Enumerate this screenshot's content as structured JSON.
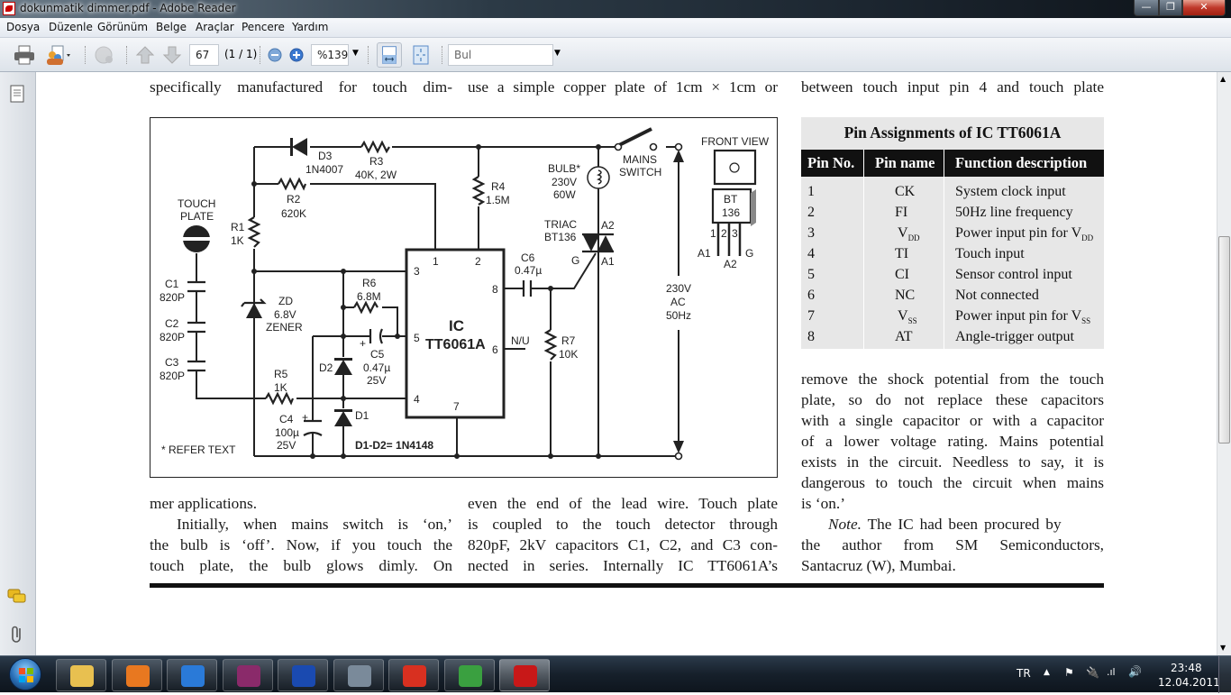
{
  "window": {
    "title": "dokunmatik dimmer.pdf - Adobe Reader",
    "controls": {
      "minimize": "—",
      "maximize": "❐",
      "close": "✕"
    }
  },
  "menu": [
    "Dosya",
    "Düzenle",
    "Görünüm",
    "Belge",
    "Araçlar",
    "Pencere",
    "Yardım"
  ],
  "toolbar": {
    "page_number": "67",
    "page_count": "(1 / 1)",
    "zoom": "%139",
    "find_placeholder": "Bul",
    "icons": [
      "print-icon",
      "collaborate-icon",
      "share-icon",
      "previous-page-icon",
      "next-page-icon",
      "zoom-out-icon",
      "zoom-in-icon",
      "fit-width-icon",
      "fit-page-icon"
    ]
  },
  "left_panel": {
    "icons": [
      "pages-icon",
      "comments-icon",
      "attachments-icon"
    ]
  },
  "document": {
    "col1_top": "specifically manufactured for touch dim-",
    "col2_top": "use a simple copper plate of 1cm × 1cm or",
    "col3_top": "between touch input pin 4 and touch plate",
    "col1_bottom": [
      "mer applications.",
      "Initially, when mains switch is ‘on,’",
      "the bulb is ‘off’. Now, if you touch the",
      "touch plate, the bulb glows dimly. On"
    ],
    "col2_bottom": [
      "even the end of the lead wire. Touch plate",
      "is coupled to the touch detector through",
      "820pF, 2kV capacitors C1, C2, and C3 con-",
      "nected in series. Internally IC TT6061A’s"
    ],
    "col3_bottom": [
      "remove the shock potential from the touch",
      "plate, so do not replace these capacitors",
      "with a single capacitor or with a capacitor",
      "of a lower voltage rating. Mains potential",
      "exists in the circuit. Needless to say, it is",
      "dangerous to touch the circuit when mains",
      "is ‘on.’"
    ],
    "note_label": "Note.",
    "note_rest": " The IC had been procured by",
    "note_lines": [
      "the author from SM Semiconductors,",
      "Santacruz (W), Mumbai."
    ]
  },
  "circuit": {
    "d3": "D3",
    "d3v": "1N4007",
    "r3": "R3",
    "r3v": "40K, 2W",
    "r2": "R2",
    "r2v": "620K",
    "r4": "R4",
    "r4v": "1.5M",
    "touch1": "TOUCH",
    "touch2": "PLATE",
    "r1": "R1",
    "r1v": "1K",
    "c1": "C1",
    "c1v": "820P",
    "c2": "C2",
    "c2v": "820P",
    "c3": "C3",
    "c3v": "820P",
    "zd": "ZD",
    "zdv": "6.8V",
    "zdt": "ZENER",
    "r6": "R6",
    "r6v": "6.8M",
    "c5": "C5",
    "c5v": "0.47µ",
    "c5w": "25V",
    "d2": "D2",
    "d1": "D1",
    "r5": "R5",
    "r5v": "1K",
    "c4": "C4",
    "c4v": "100µ",
    "c4w": "25V",
    "note": "* REFER TEXT",
    "dnote": "D1-D2= 1N4148",
    "ic1": "IC",
    "ic2": "TT6061A",
    "p1": "1",
    "p2": "2",
    "p3": "3",
    "p4": "4",
    "p5": "5",
    "p6": "6",
    "p7": "7",
    "p8": "8",
    "nu": "N/U",
    "c6": "C6",
    "c6v": "0.47µ",
    "r7": "R7",
    "r7v": "10K",
    "bulb": "BULB*",
    "bulbv": "230V",
    "bulbw": "60W",
    "sw1": "MAINS",
    "sw2": "SWITCH",
    "triac": "TRIAC",
    "triacv": "BT136",
    "a2": "A2",
    "a1": "A1",
    "g": "G",
    "ac1": "230V",
    "ac2": "AC",
    "ac3": "50Hz",
    "fv": "FRONT VIEW",
    "bt1": "BT",
    "bt2": "136",
    "l1": "1",
    "l2": "2",
    "l3": "3",
    "la1": "A1",
    "la2": "A2",
    "lg": "G"
  },
  "pin_table": {
    "title": "Pin Assignments of IC TT6061A",
    "headers": [
      "Pin No.",
      "Pin name",
      "Function description"
    ],
    "rows": [
      {
        "no": "1",
        "name": "CK",
        "func": "System clock input"
      },
      {
        "no": "2",
        "name": "FI",
        "func": "50Hz line frequency"
      },
      {
        "no": "3",
        "name": "V",
        "name_sub": "DD",
        "func": "Power input pin for V",
        "func_sub": "DD"
      },
      {
        "no": "4",
        "name": "TI",
        "func": "Touch input"
      },
      {
        "no": "5",
        "name": "CI",
        "func": "Sensor control input"
      },
      {
        "no": "6",
        "name": "NC",
        "func": "Not connected"
      },
      {
        "no": "7",
        "name": "V",
        "name_sub": "SS",
        "func": "Power input pin for V",
        "func_sub": "SS"
      },
      {
        "no": "8",
        "name": "AT",
        "func": "Angle-trigger output"
      }
    ]
  },
  "taskbar": {
    "apps": [
      "windows-explorer",
      "media-player",
      "internet-explorer",
      "winrar",
      "isis-proteus",
      "maxthon",
      "gmail",
      "messenger",
      "adobe-reader"
    ],
    "app_colors": [
      "#e8c050",
      "#e87820",
      "#2a7ad8",
      "#8a2a6a",
      "#1a4ab0",
      "#7a8a9a",
      "#d83020",
      "#3aa040",
      "#c81818"
    ],
    "language": "TR",
    "time": "23:48",
    "date": "12.04.2011"
  }
}
